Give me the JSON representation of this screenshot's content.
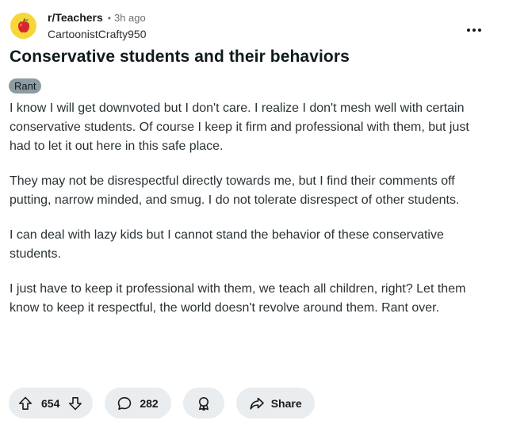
{
  "post": {
    "subreddit": "r/Teachers",
    "separator": "•",
    "time_ago": "3h ago",
    "author": "CartoonistCrafty950",
    "title": "Conservative students and their behaviors",
    "flair": "Rant",
    "paragraphs": [
      "I know I will get downvoted but I don't care. I realize I don't mesh well with certain conservative students. Of course I keep it firm and professional with them, but just had to let it out here in this safe place.",
      "They may not be disrespectful directly towards me, but I find their comments off putting, narrow minded, and smug. I do not tolerate disrespect of other students.",
      "I can deal with lazy kids but I cannot stand the behavior of these conservative students.",
      "I just have to keep it professional with them, we teach all children, right? Let them know to keep it respectful, the world doesn't revolve around them. Rant over."
    ]
  },
  "actions": {
    "score": "654",
    "comments": "282",
    "share_label": "Share"
  },
  "icons": {
    "avatar": "apple-icon",
    "more": "more-options-icon",
    "upvote": "upvote-arrow-icon",
    "downvote": "downvote-arrow-icon",
    "comment": "comment-bubble-icon",
    "award": "award-icon",
    "share": "share-arrow-icon"
  },
  "colors": {
    "avatar_bg": "#f7d63a",
    "flair_bg": "#8d9ba3",
    "pill_bg": "#e9edef"
  }
}
